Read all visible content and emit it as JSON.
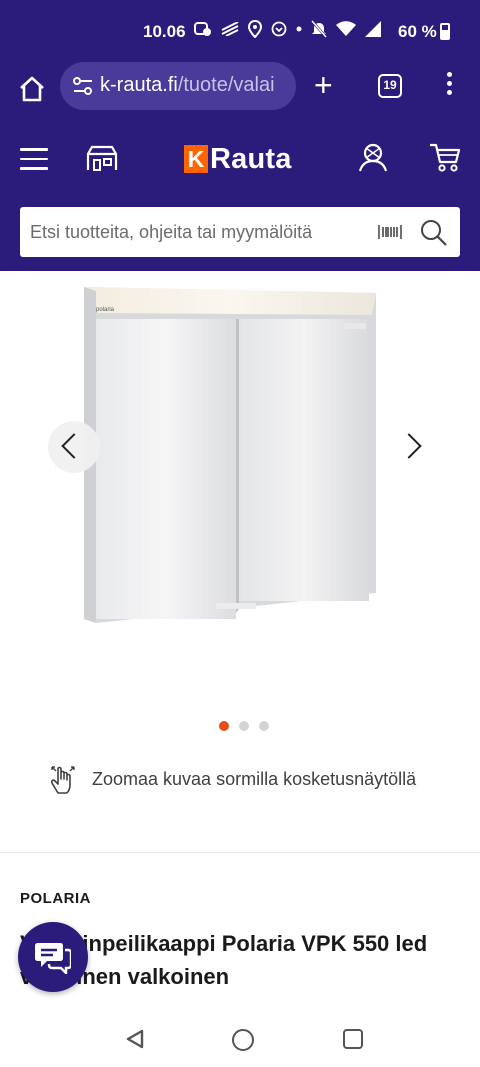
{
  "status_bar": {
    "time": "10.06",
    "battery": "60 %"
  },
  "browser": {
    "url_domain": "k-rauta.fi",
    "url_path": "/tuote/valai",
    "tab_count": "19"
  },
  "site": {
    "logo_letter": "K",
    "logo_word": "Rauta",
    "brand_color": "#2b1b7a",
    "accent_color": "#ff6600",
    "search_placeholder": "Etsi tuotteita, ohjeita tai myymälöitä"
  },
  "gallery": {
    "image_count": 3,
    "active_index": 0,
    "cabinet_label": "polaria",
    "zoom_hint": "Zoomaa kuvaa sormilla kosketusnäytöllä"
  },
  "product": {
    "brand": "POLARIA",
    "title": "Valaisinpeilikaappi Polaria VPK 550 led valkoinen valkoinen"
  }
}
